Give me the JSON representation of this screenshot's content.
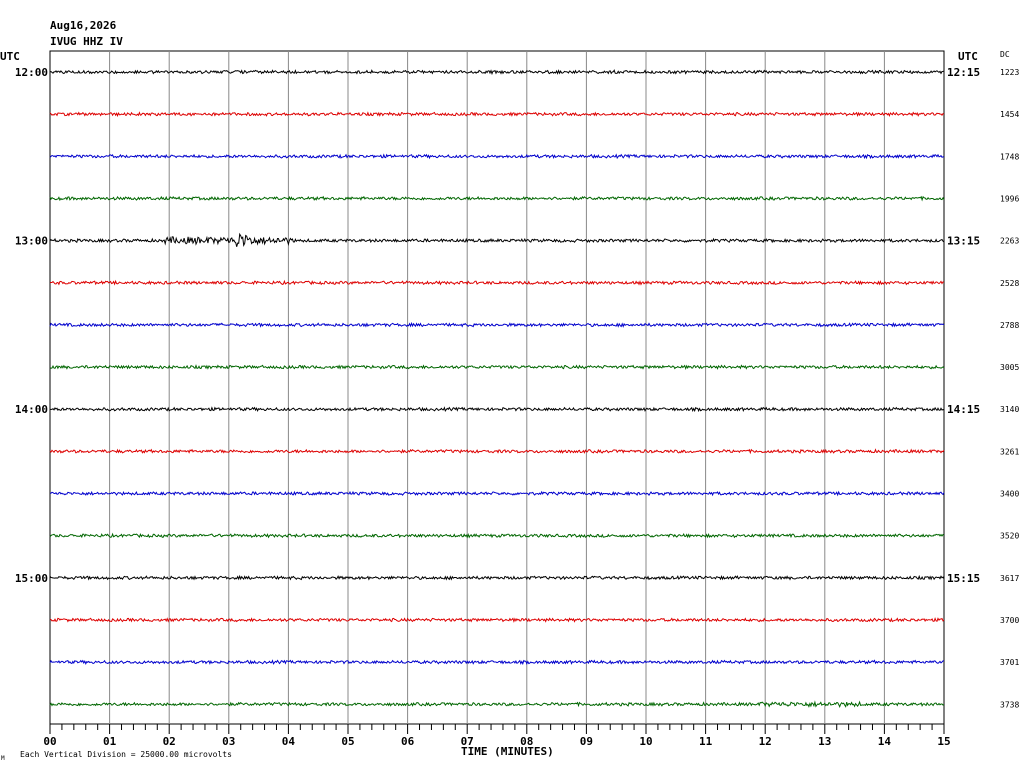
{
  "header": {
    "date": "Aug16,2026",
    "station": "IVUG HHZ IV",
    "utc_left": "UTC",
    "utc_right": "UTC",
    "dc_label": "DC"
  },
  "footer": {
    "xlabel": "TIME (MINUTES)",
    "scale_note": "Each Vertical Division = 25000.00 microvolts",
    "corner_mark": "M"
  },
  "chart_data": {
    "type": "line",
    "title": "",
    "xlabel": "TIME (MINUTES)",
    "ylabel": "",
    "xlim": [
      0,
      15
    ],
    "x_ticks": [
      "00",
      "01",
      "02",
      "03",
      "04",
      "05",
      "06",
      "07",
      "08",
      "09",
      "10",
      "11",
      "12",
      "13",
      "14",
      "15"
    ],
    "grid": true,
    "trace_colors": [
      "#000000",
      "#dd0000",
      "#0000cc",
      "#006600"
    ],
    "series": [
      {
        "start_label": "12:00",
        "end_label": "12:15",
        "dc": "1223"
      },
      {
        "start_label": "",
        "end_label": "",
        "dc": "1454"
      },
      {
        "start_label": "",
        "end_label": "",
        "dc": "1748"
      },
      {
        "start_label": "",
        "end_label": "",
        "dc": "1996"
      },
      {
        "start_label": "13:00",
        "end_label": "13:15",
        "dc": "2263"
      },
      {
        "start_label": "",
        "end_label": "",
        "dc": "2528"
      },
      {
        "start_label": "",
        "end_label": "",
        "dc": "2788"
      },
      {
        "start_label": "",
        "end_label": "",
        "dc": "3005"
      },
      {
        "start_label": "14:00",
        "end_label": "14:15",
        "dc": "3140"
      },
      {
        "start_label": "",
        "end_label": "",
        "dc": "3261"
      },
      {
        "start_label": "",
        "end_label": "",
        "dc": "3400"
      },
      {
        "start_label": "",
        "end_label": "",
        "dc": "3520"
      },
      {
        "start_label": "15:00",
        "end_label": "15:15",
        "dc": "3617"
      },
      {
        "start_label": "",
        "end_label": "",
        "dc": "3700"
      },
      {
        "start_label": "",
        "end_label": "",
        "dc": "3701"
      },
      {
        "start_label": "",
        "end_label": "",
        "dc": "3738"
      }
    ]
  }
}
